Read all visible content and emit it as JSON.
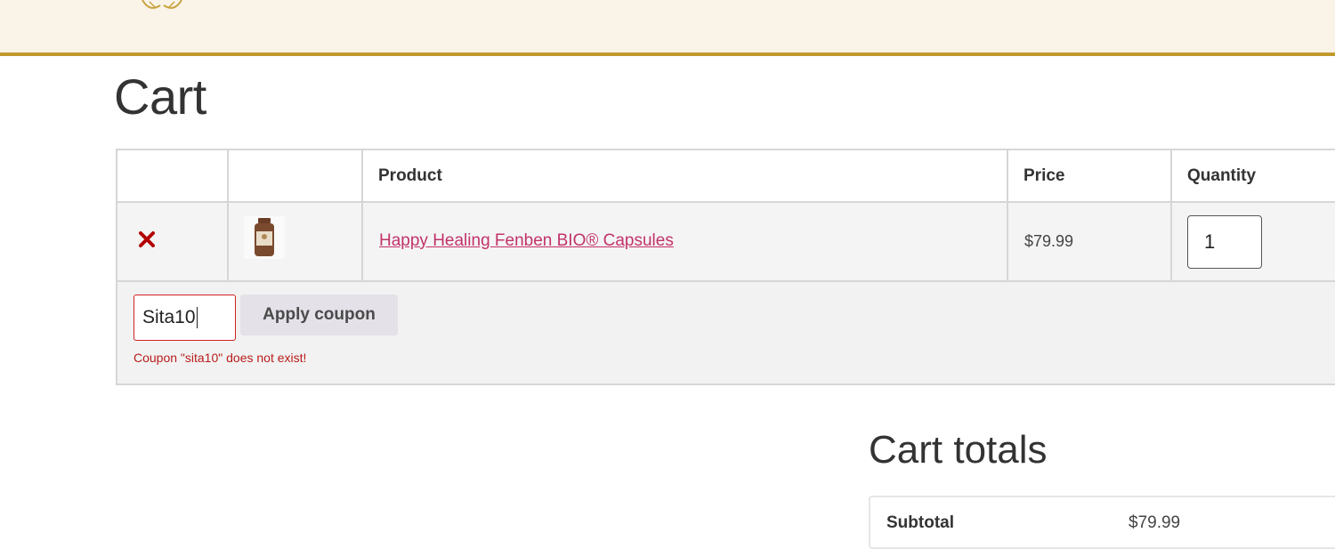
{
  "page": {
    "title": "Cart"
  },
  "table": {
    "headers": {
      "product": "Product",
      "price": "Price",
      "quantity": "Quantity"
    },
    "items": [
      {
        "name": "Happy Healing Fenben BIO® Capsules",
        "price": "$79.99",
        "quantity": "1",
        "remove_icon": "close-icon",
        "thumbnail": "product-bottle-image"
      }
    ]
  },
  "coupon": {
    "input_value": "Sita10",
    "apply_label": "Apply coupon",
    "error": "Coupon \"sita10\" does not exist!"
  },
  "totals": {
    "title": "Cart totals",
    "subtotal_label": "Subtotal",
    "subtotal_value": "$79.99"
  },
  "colors": {
    "accent_border": "#c19a2e",
    "header_bg": "#faf3e7",
    "link": "#c2336a",
    "error": "#b81c1c"
  }
}
